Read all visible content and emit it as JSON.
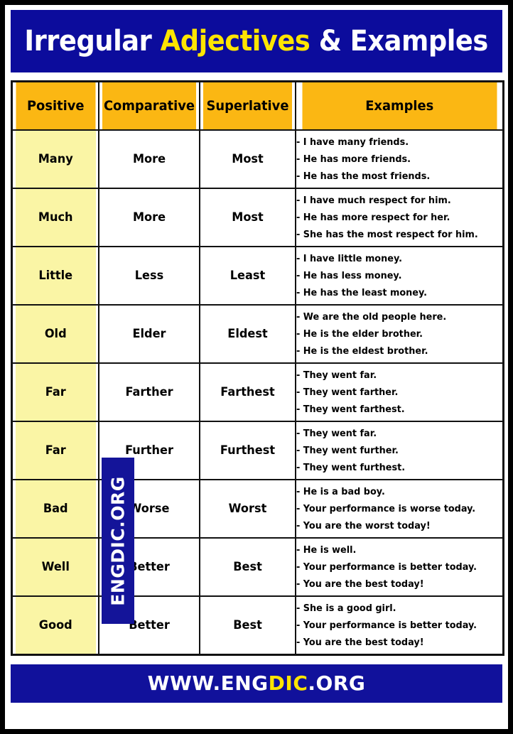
{
  "colors": {
    "header_blue": "#0c0c9c",
    "footer_blue": "#11119b",
    "accent_yellow": "#ffe500",
    "table_header_orange": "#fbb713",
    "positive_column_yellow": "#faf5a5",
    "border_black": "#111111",
    "watermark_blue": "#141499"
  },
  "title": {
    "part1": "Irregular ",
    "highlight": "Adjectives",
    "part2": " & Examples"
  },
  "watermark": {
    "label": "ENGDIC.ORG"
  },
  "footer": {
    "part1": "WWW.ENG",
    "highlight": "DIC",
    "part2": ".ORG"
  },
  "table": {
    "columns": [
      "Positive",
      "Comparative",
      "Superlative",
      "Examples"
    ],
    "rows": [
      {
        "positive": "Many",
        "comparative": "More",
        "superlative": "Most",
        "examples": [
          "- I have many friends.",
          "- He has more friends.",
          "- He has the most friends."
        ]
      },
      {
        "positive": "Much",
        "comparative": "More",
        "superlative": "Most",
        "examples": [
          "- I have much respect for him.",
          "- He has more respect for her.",
          "- She has the most respect for him."
        ]
      },
      {
        "positive": "Little",
        "comparative": "Less",
        "superlative": "Least",
        "examples": [
          "- I have little money.",
          "- He has less money.",
          "- He has the least money."
        ]
      },
      {
        "positive": "Old",
        "comparative": "Elder",
        "superlative": "Eldest",
        "examples": [
          "- We are the old people here.",
          "- He is the elder brother.",
          "- He is the eldest brother."
        ]
      },
      {
        "positive": "Far",
        "comparative": "Farther",
        "superlative": "Farthest",
        "examples": [
          "- They went far.",
          "- They went farther.",
          "- They went farthest."
        ]
      },
      {
        "positive": "Far",
        "comparative": "Further",
        "superlative": "Furthest",
        "examples": [
          "- They went far.",
          "- They went further.",
          "- They went furthest."
        ]
      },
      {
        "positive": "Bad",
        "comparative": "Worse",
        "superlative": "Worst",
        "examples": [
          "- He is a bad boy.",
          "- Your performance is worse today.",
          "- You are the worst today!"
        ]
      },
      {
        "positive": "Well",
        "comparative": "Better",
        "superlative": "Best",
        "examples": [
          "- He is well.",
          "- Your performance is better today.",
          "- You are the best today!"
        ]
      },
      {
        "positive": "Good",
        "comparative": "Better",
        "superlative": "Best",
        "examples": [
          "- She is a good girl.",
          "- Your performance is better today.",
          "- You are the best today!"
        ]
      }
    ]
  }
}
